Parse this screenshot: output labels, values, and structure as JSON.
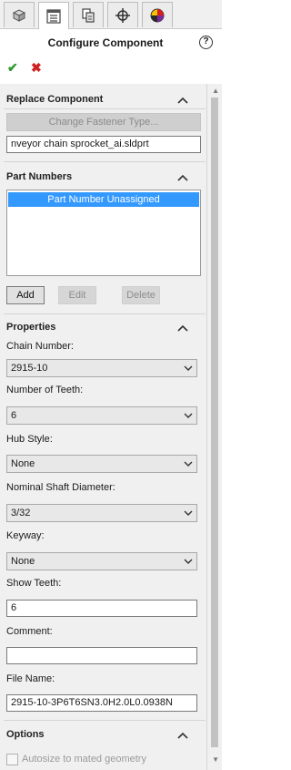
{
  "tabs": [
    {
      "icon": "feature-manager-icon"
    },
    {
      "icon": "property-manager-icon"
    },
    {
      "icon": "configuration-manager-icon"
    },
    {
      "icon": "dimxpert-icon"
    },
    {
      "icon": "display-manager-icon"
    }
  ],
  "header": {
    "title": "Configure Component",
    "help": "?",
    "ok": "✔",
    "cancel": "✖"
  },
  "colors": {
    "ok": "#2d9b2d",
    "cancel": "#d02020",
    "selection": "#3399ff",
    "panel": "#f0f0f0"
  },
  "replace_component": {
    "title": "Replace Component",
    "change_fastener_button": "Change Fastener Type...",
    "file_value": "nveyor chain sprocket_ai.sldprt"
  },
  "part_numbers": {
    "title": "Part Numbers",
    "items": [
      "Part Number Unassigned"
    ],
    "add": "Add",
    "edit": "Edit",
    "delete": "Delete"
  },
  "properties": {
    "title": "Properties",
    "chain_number_label": "Chain Number:",
    "chain_number_value": "2915-10",
    "teeth_label": "Number of Teeth:",
    "teeth_value": "6",
    "hub_style_label": "Hub Style:",
    "hub_style_value": "None",
    "shaft_label": "Nominal Shaft Diameter:",
    "shaft_value": "3/32",
    "keyway_label": "Keyway:",
    "keyway_value": "None",
    "show_teeth_label": "Show Teeth:",
    "show_teeth_value": "6",
    "comment_label": "Comment:",
    "comment_value": "",
    "file_name_label": "File Name:",
    "file_name_value": "2915-10-3P6T6SN3.0H2.0L0.0938N"
  },
  "options": {
    "title": "Options",
    "autosize_label": "Autosize to mated geometry"
  }
}
